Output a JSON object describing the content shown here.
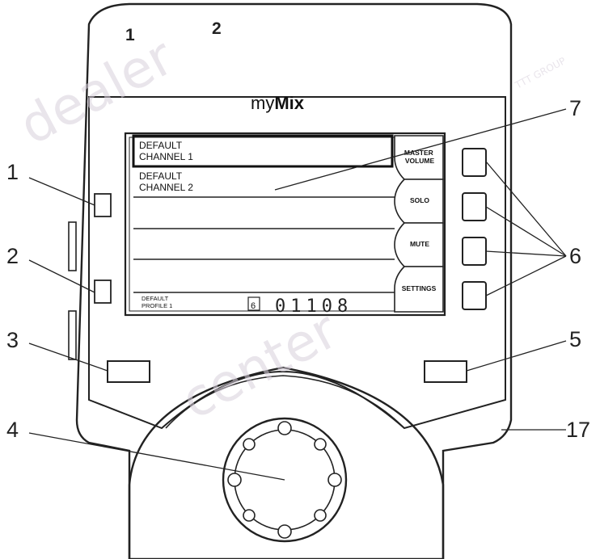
{
  "device": {
    "brand_prefix": "my",
    "brand_suffix": "Mix",
    "top_jack_1": "1",
    "top_jack_2": "2"
  },
  "screen": {
    "channels": [
      "DEFAULT\nCHANNEL 1",
      "DEFAULT\nCHANNEL 2"
    ],
    "profile": "DEFAULT\nPROFILE 1",
    "status_small": "6",
    "status_code": "01108"
  },
  "softkeys": [
    "MASTER\nVOLUME",
    "SOLO",
    "MUTE",
    "SETTINGS"
  ],
  "callouts": {
    "c1": "1",
    "c2": "2",
    "c3": "3",
    "c4": "4",
    "c5": "5",
    "c6": "6",
    "c7": "7",
    "c17": "17"
  },
  "watermark": [
    "dealer",
    "center",
    "TTT GROUP"
  ],
  "colors": {
    "line": "#222222",
    "watermark": "#d8d0dc",
    "lcd_bg": "#ffffff"
  }
}
